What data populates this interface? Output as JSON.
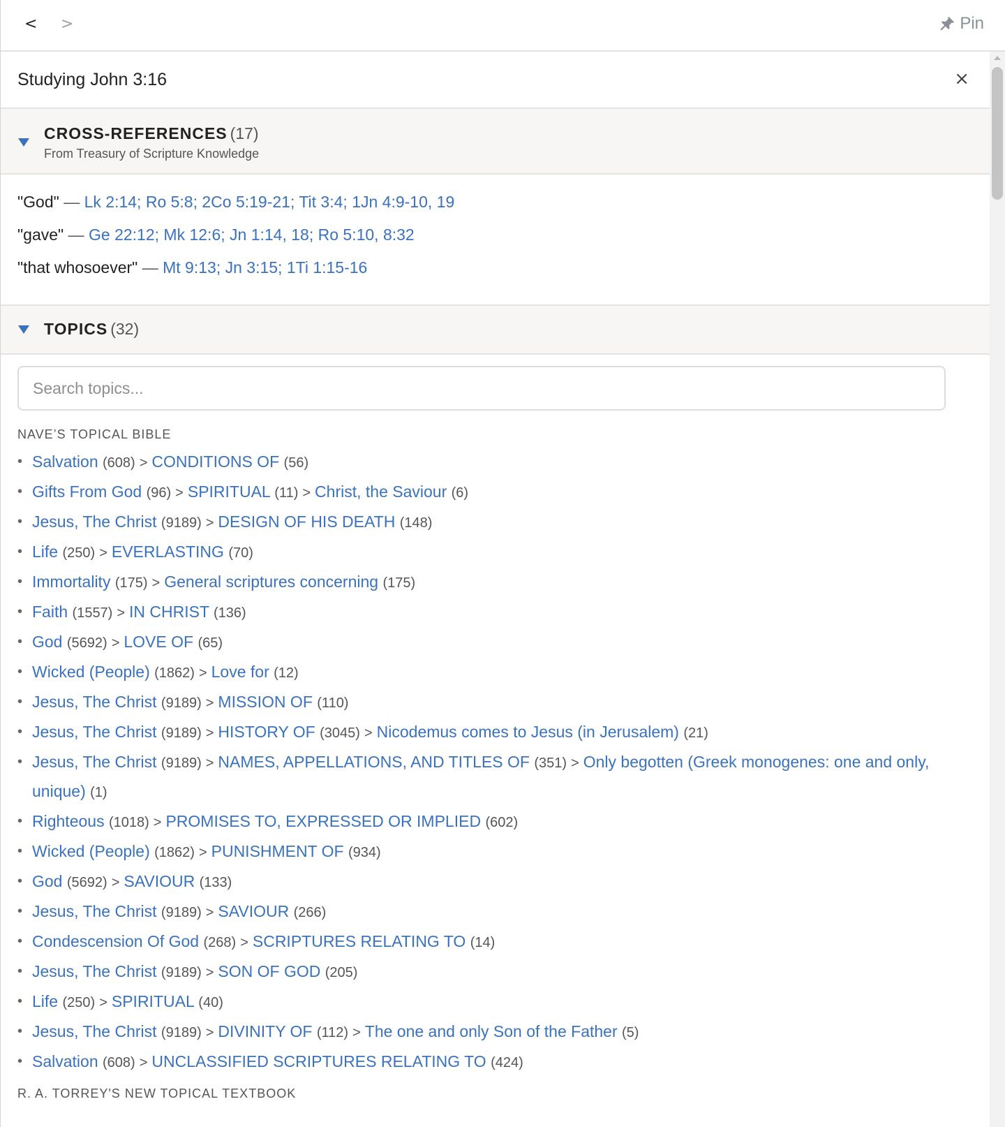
{
  "nav": {
    "back": "<",
    "forward": ">",
    "pin_label": "Pin"
  },
  "study": {
    "title": "Studying John 3:16",
    "close": "×"
  },
  "cross_references": {
    "title": "CROSS-REFERENCES",
    "count": "(17)",
    "subtitle": "From Treasury of Scripture Knowledge",
    "entries": [
      {
        "term": "\"God\"",
        "refs": [
          "Lk 2:14",
          "Ro 5:8",
          "2Co 5:19-21",
          "Tit 3:4",
          "1Jn 4:9-10, 19"
        ]
      },
      {
        "term": "\"gave\"",
        "refs": [
          "Ge 22:12",
          "Mk 12:6",
          "Jn 1:14, 18",
          "Ro 5:10, 8:32"
        ]
      },
      {
        "term": "\"that whosoever\"",
        "refs": [
          "Mt 9:13",
          "Jn 3:15",
          "1Ti 1:15-16"
        ]
      }
    ]
  },
  "topics": {
    "title": "TOPICS",
    "count": "(32)",
    "search_placeholder": "Search topics...",
    "sources": [
      {
        "name": "NAVE’S TOPICAL BIBLE",
        "items": [
          [
            [
              "Salvation",
              "(608)"
            ],
            [
              "CONDITIONS OF",
              "(56)"
            ]
          ],
          [
            [
              "Gifts From God",
              "(96)"
            ],
            [
              "SPIRITUAL",
              "(11)"
            ],
            [
              "Christ, the Saviour",
              "(6)"
            ]
          ],
          [
            [
              "Jesus, The Christ",
              "(9189)"
            ],
            [
              "DESIGN OF HIS DEATH",
              "(148)"
            ]
          ],
          [
            [
              "Life",
              "(250)"
            ],
            [
              "EVERLASTING",
              "(70)"
            ]
          ],
          [
            [
              "Immortality",
              "(175)"
            ],
            [
              "General scriptures concerning",
              "(175)"
            ]
          ],
          [
            [
              "Faith",
              "(1557)"
            ],
            [
              "IN CHRIST",
              "(136)"
            ]
          ],
          [
            [
              "God",
              "(5692)"
            ],
            [
              "LOVE OF",
              "(65)"
            ]
          ],
          [
            [
              "Wicked (People)",
              "(1862)"
            ],
            [
              "Love for",
              "(12)"
            ]
          ],
          [
            [
              "Jesus, The Christ",
              "(9189)"
            ],
            [
              "MISSION OF",
              "(110)"
            ]
          ],
          [
            [
              "Jesus, The Christ",
              "(9189)"
            ],
            [
              "HISTORY OF",
              "(3045)"
            ],
            [
              "Nicodemus comes to Jesus (in Jerusalem)",
              "(21)"
            ]
          ],
          [
            [
              "Jesus, The Christ",
              "(9189)"
            ],
            [
              "NAMES, APPELLATIONS, AND TITLES OF",
              "(351)"
            ],
            [
              "Only begotten (Greek monogenes: one and only, unique)",
              "(1)"
            ]
          ],
          [
            [
              "Righteous",
              "(1018)"
            ],
            [
              "PROMISES TO, EXPRESSED OR IMPLIED",
              "(602)"
            ]
          ],
          [
            [
              "Wicked (People)",
              "(1862)"
            ],
            [
              "PUNISHMENT OF",
              "(934)"
            ]
          ],
          [
            [
              "God",
              "(5692)"
            ],
            [
              "SAVIOUR",
              "(133)"
            ]
          ],
          [
            [
              "Jesus, The Christ",
              "(9189)"
            ],
            [
              "SAVIOUR",
              "(266)"
            ]
          ],
          [
            [
              "Condescension Of God",
              "(268)"
            ],
            [
              "SCRIPTURES RELATING TO",
              "(14)"
            ]
          ],
          [
            [
              "Jesus, The Christ",
              "(9189)"
            ],
            [
              "SON OF GOD",
              "(205)"
            ]
          ],
          [
            [
              "Life",
              "(250)"
            ],
            [
              "SPIRITUAL",
              "(40)"
            ]
          ],
          [
            [
              "Jesus, The Christ",
              "(9189)"
            ],
            [
              "DIVINITY OF",
              "(112)"
            ],
            [
              "The one and only Son of the Father",
              "(5)"
            ]
          ],
          [
            [
              "Salvation",
              "(608)"
            ],
            [
              "UNCLASSIFIED SCRIPTURES RELATING TO",
              "(424)"
            ]
          ]
        ]
      },
      {
        "name": "R. A. TORREY'S NEW TOPICAL TEXTBOOK",
        "items": []
      }
    ]
  },
  "colors": {
    "link": "#3a72bd",
    "section_bg": "#f7f6f4"
  }
}
